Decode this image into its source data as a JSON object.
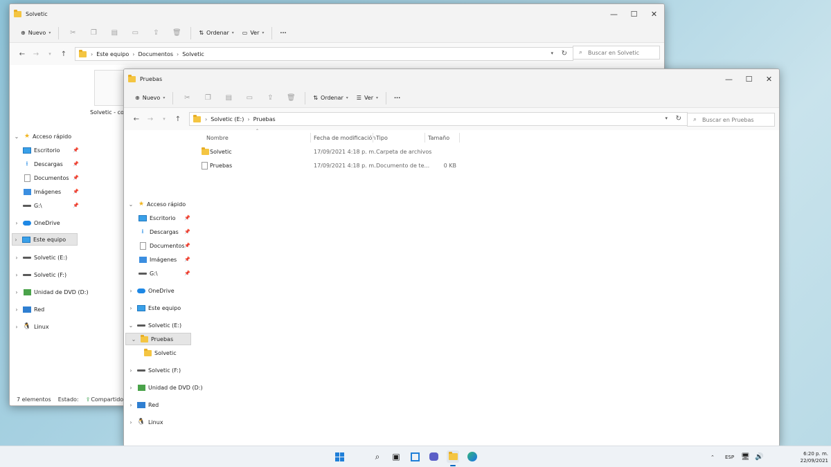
{
  "back_window": {
    "title": "Solvetic",
    "toolbar": {
      "new_label": "Nuevo",
      "sort_label": "Ordenar",
      "view_label": "Ver",
      "more": "···"
    },
    "address": {
      "crumbs": [
        "Este equipo",
        "Documentos",
        "Solvetic"
      ]
    },
    "search_placeholder": "Buscar en Solvetic",
    "sidebar": {
      "quick_access": "Acceso rápido",
      "items": [
        "Escritorio",
        "Descargas",
        "Documentos",
        "Imágenes",
        "G:\\"
      ],
      "onedrive": "OneDrive",
      "this_pc": "Este equipo",
      "drive_e": "Solvetic (E:)",
      "drive_f": "Solvetic (F:)",
      "dvd": "Unidad de DVD (D:)",
      "network": "Red",
      "linux": "Linux"
    },
    "file_caption": "Solvetic - copia",
    "status": {
      "count": "7 elementos",
      "state": "Estado:",
      "shared": "Compartido"
    }
  },
  "front_window": {
    "title": "Pruebas",
    "toolbar": {
      "new_label": "Nuevo",
      "sort_label": "Ordenar",
      "view_label": "Ver",
      "more": "···"
    },
    "address": {
      "crumbs": [
        "Solvetic (E:)",
        "Pruebas"
      ]
    },
    "search_placeholder": "Buscar en Pruebas",
    "sidebar": {
      "quick_access": "Acceso rápido",
      "items": [
        "Escritorio",
        "Descargas",
        "Documentos",
        "Imágenes",
        "G:\\"
      ],
      "onedrive": "OneDrive",
      "this_pc": "Este equipo",
      "drive_e": "Solvetic (E:)",
      "pruebas": "Pruebas",
      "sub_solvetic": "Solvetic",
      "drive_f": "Solvetic (F:)",
      "dvd": "Unidad de DVD (D:)",
      "network": "Red",
      "linux": "Linux"
    },
    "columns": {
      "name": "Nombre",
      "date": "Fecha de modificación",
      "type": "Tipo",
      "size": "Tamaño"
    },
    "files": [
      {
        "name": "Solvetic",
        "date": "17/09/2021 4:18 p. m.",
        "type": "Carpeta de archivos",
        "size": ""
      },
      {
        "name": "Pruebas",
        "date": "17/09/2021 4:18 p. m.",
        "type": "Documento de te...",
        "size": "0 KB"
      }
    ]
  },
  "taskbar": {
    "lang": "ESP",
    "time": "6:20 p. m.",
    "date": "22/09/2021"
  },
  "colors": {
    "accent": "#0067c0",
    "folder": "#f4c542",
    "selection": "#e5e5e5"
  }
}
